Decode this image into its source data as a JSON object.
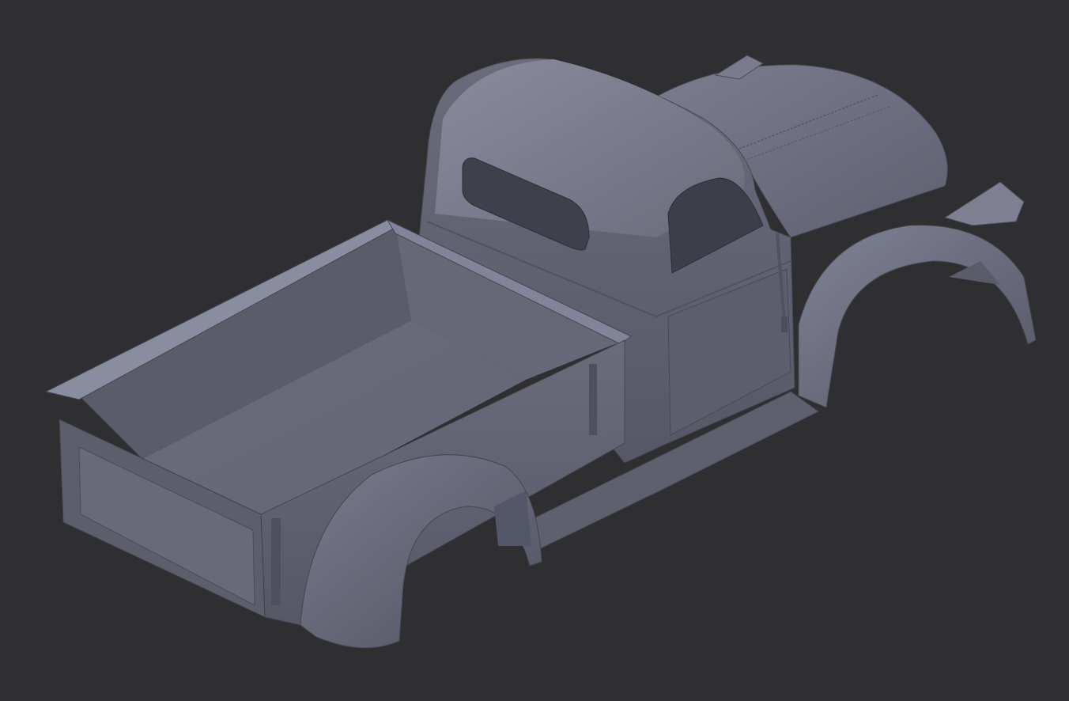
{
  "viewport": {
    "background_color": "#2f2f31",
    "model_color": "#6c6e7f",
    "shadow_color": "#4a4c5a",
    "highlight_color": "#8c8ea0",
    "subject": "pickup-truck-body-3d-model"
  }
}
